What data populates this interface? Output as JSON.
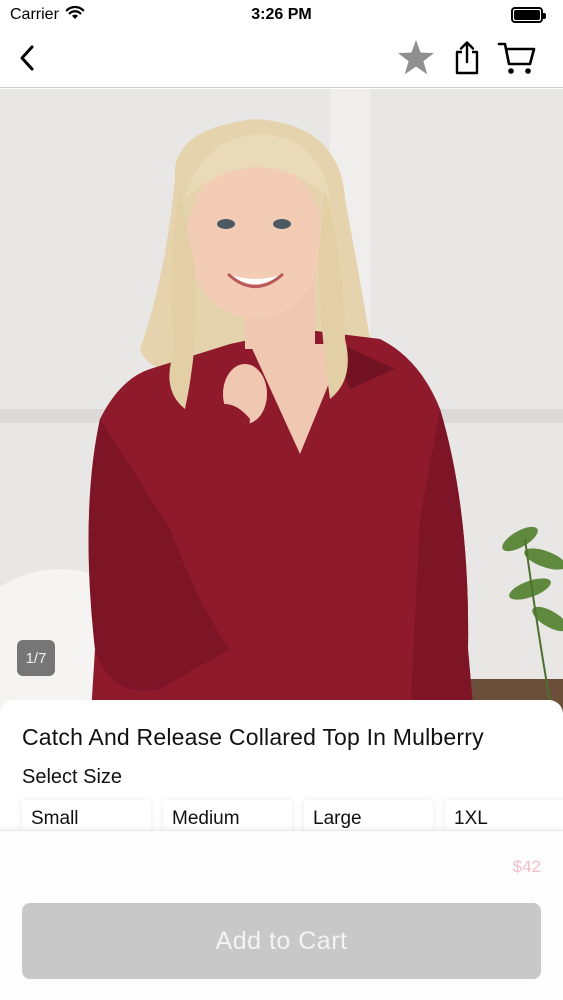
{
  "status_bar": {
    "carrier": "Carrier",
    "time": "3:26 PM",
    "wifi_icon": "wifi-icon",
    "battery_level": 1.0
  },
  "nav": {
    "back_icon": "chevron-left-icon",
    "favorite_icon": "star-icon",
    "share_icon": "share-icon",
    "cart_icon": "cart-icon"
  },
  "product": {
    "image_counter": "1/7",
    "title": "Catch And Release Collared Top In Mulberry",
    "select_size_label": "Select Size",
    "sizes": [
      "Small",
      "Medium",
      "Large",
      "1XL"
    ],
    "price": "$42",
    "garment_color": "#8e1a2c"
  },
  "actions": {
    "add_to_cart_label": "Add to Cart"
  }
}
